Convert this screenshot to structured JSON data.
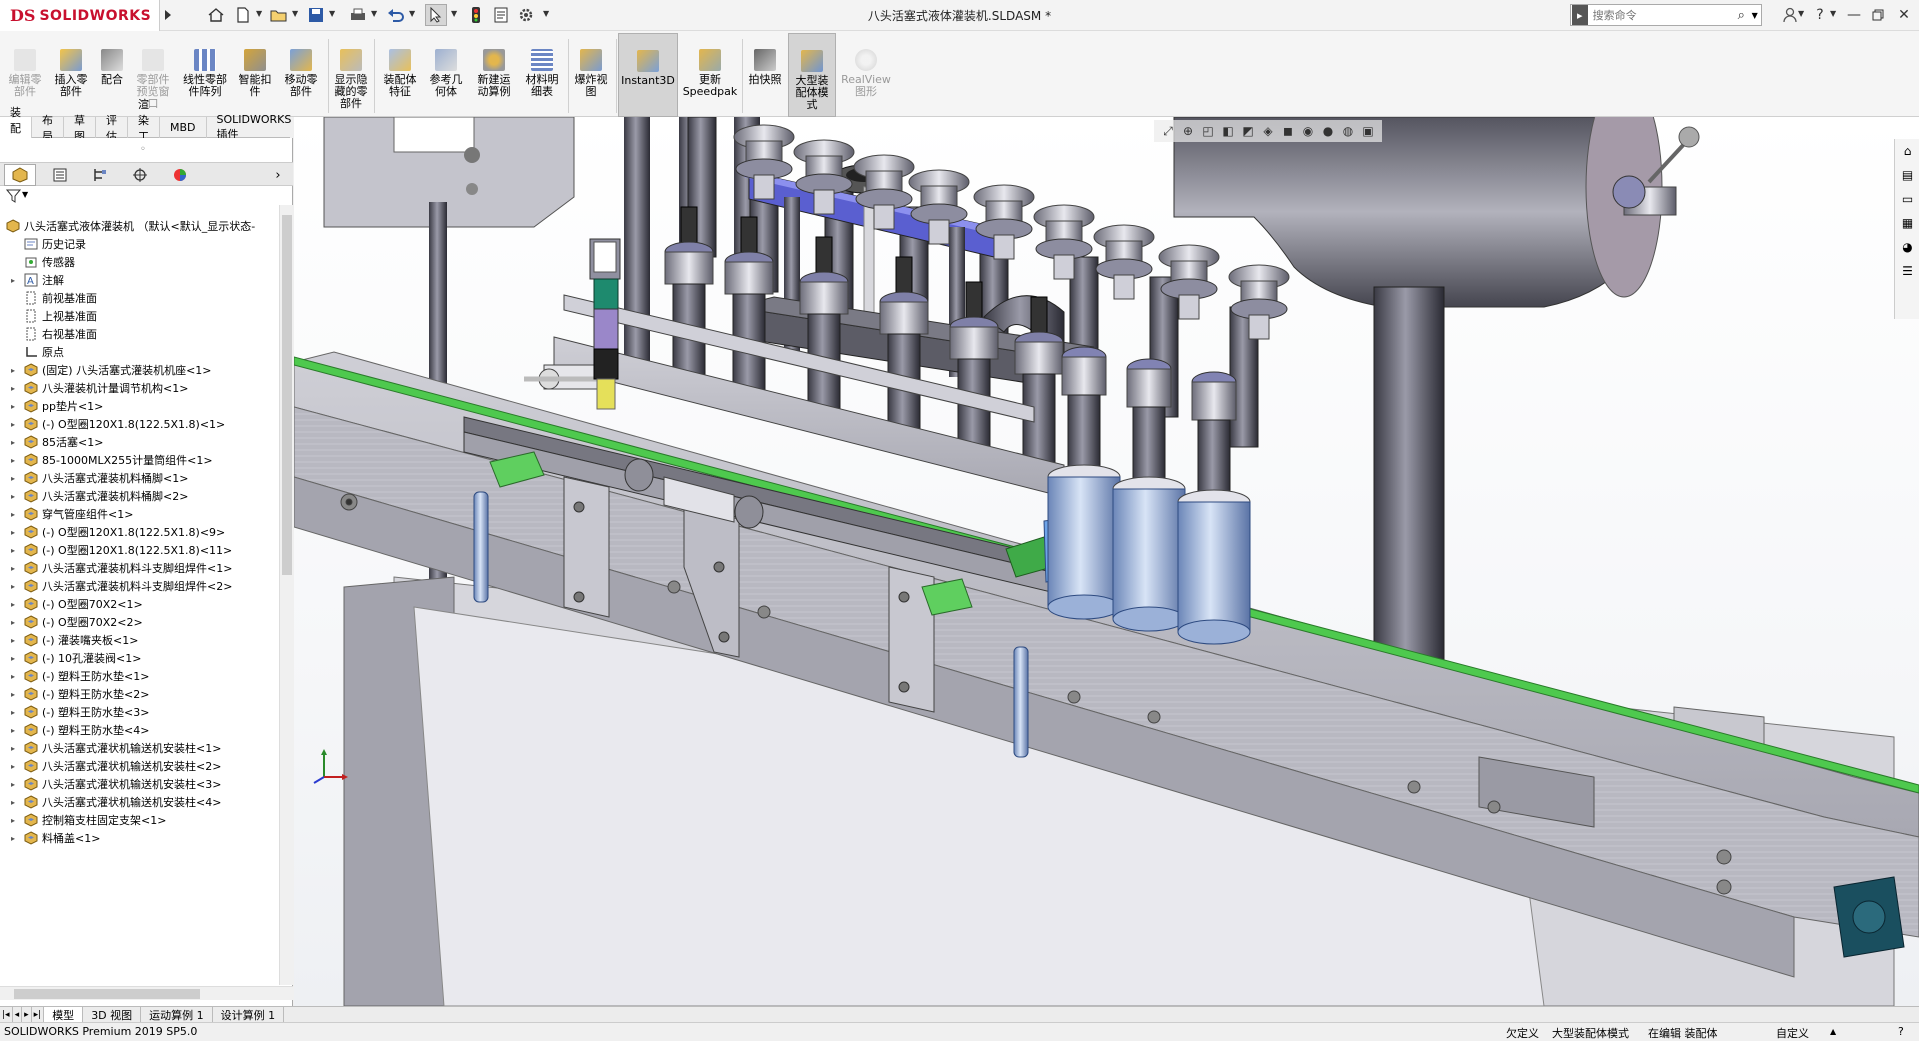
{
  "titlebar": {
    "brand": "SOLIDWORKS",
    "brand_mark": "DS",
    "document_title": "八头活塞式液体灌装机.SLDASM *",
    "search_placeholder": "搜索命令"
  },
  "ribbon": {
    "buttons": [
      {
        "label": "编辑零\n部件",
        "enabled": false
      },
      {
        "label": "插入零\n部件",
        "enabled": true
      },
      {
        "label": "配合",
        "enabled": true
      },
      {
        "label": "零部件\n预览窗\n口",
        "enabled": false
      },
      {
        "label": "线性零部\n件阵列",
        "enabled": true
      },
      {
        "label": "智能扣\n件",
        "enabled": true
      },
      {
        "label": "移动零\n部件",
        "enabled": true
      },
      {
        "label": "显示隐\n藏的零\n部件",
        "enabled": true
      },
      {
        "label": "装配体\n特征",
        "enabled": true
      },
      {
        "label": "参考几\n何体",
        "enabled": true
      },
      {
        "label": "新建运\n动算例",
        "enabled": true
      },
      {
        "label": "材料明\n细表",
        "enabled": true
      },
      {
        "label": "爆炸视\n图",
        "enabled": true
      },
      {
        "label": "Instant3D",
        "enabled": true,
        "active": true
      },
      {
        "label": "更新\nSpeedpak",
        "enabled": true
      },
      {
        "label": "拍快照",
        "enabled": true
      },
      {
        "label": "大型装\n配体模\n式",
        "enabled": true,
        "active": true
      },
      {
        "label": "RealView\n图形",
        "enabled": false
      }
    ]
  },
  "command_tabs": [
    "装配体",
    "布局",
    "草图",
    "评估",
    "渲染工具",
    "MBD",
    "SOLIDWORKS 插件"
  ],
  "feature_tree": {
    "root": "八头活塞式液体灌装机 （默认<默认_显示状态-",
    "items": [
      {
        "label": "历史记录",
        "expand": false,
        "icon": "history-icon"
      },
      {
        "label": "传感器",
        "expand": false,
        "icon": "sensor-icon"
      },
      {
        "label": "注解",
        "expand": true,
        "icon": "annotation-icon"
      },
      {
        "label": "前视基准面",
        "expand": false,
        "icon": "plane-icon"
      },
      {
        "label": "上视基准面",
        "expand": false,
        "icon": "plane-icon"
      },
      {
        "label": "右视基准面",
        "expand": false,
        "icon": "plane-icon"
      },
      {
        "label": "原点",
        "expand": false,
        "icon": "origin-icon"
      },
      {
        "label": "(固定) 八头活塞式灌装机机座<1>",
        "expand": true,
        "icon": "assembly-icon"
      },
      {
        "label": "八头灌装机计量调节机构<1>",
        "expand": true,
        "icon": "assembly-icon"
      },
      {
        "label": "pp垫片<1>",
        "expand": true,
        "icon": "assembly-icon"
      },
      {
        "label": "(-) O型圈120X1.8(122.5X1.8)<1>",
        "expand": true,
        "icon": "assembly-icon"
      },
      {
        "label": "85活塞<1>",
        "expand": true,
        "icon": "assembly-icon"
      },
      {
        "label": "85-1000MLX255计量筒组件<1>",
        "expand": true,
        "icon": "assembly-icon"
      },
      {
        "label": "八头活塞式灌装机料桶脚<1>",
        "expand": true,
        "icon": "assembly-icon"
      },
      {
        "label": "八头活塞式灌装机料桶脚<2>",
        "expand": true,
        "icon": "assembly-icon"
      },
      {
        "label": "穿气管座组件<1>",
        "expand": true,
        "icon": "assembly-icon"
      },
      {
        "label": "(-) O型圈120X1.8(122.5X1.8)<9>",
        "expand": true,
        "icon": "assembly-icon"
      },
      {
        "label": "(-) O型圈120X1.8(122.5X1.8)<11>",
        "expand": true,
        "icon": "assembly-icon"
      },
      {
        "label": "八头活塞式灌装机料斗支脚组焊件<1>",
        "expand": true,
        "icon": "assembly-icon"
      },
      {
        "label": "八头活塞式灌装机料斗支脚组焊件<2>",
        "expand": true,
        "icon": "assembly-icon"
      },
      {
        "label": "(-) O型圈70X2<1>",
        "expand": true,
        "icon": "assembly-icon"
      },
      {
        "label": "(-) O型圈70X2<2>",
        "expand": true,
        "icon": "assembly-icon"
      },
      {
        "label": "(-) 灌装嘴夹板<1>",
        "expand": true,
        "icon": "assembly-icon"
      },
      {
        "label": "(-) 10孔灌装阀<1>",
        "expand": true,
        "icon": "assembly-icon"
      },
      {
        "label": "(-) 塑料王防水垫<1>",
        "expand": true,
        "icon": "assembly-icon"
      },
      {
        "label": "(-) 塑料王防水垫<2>",
        "expand": true,
        "icon": "assembly-icon"
      },
      {
        "label": "(-) 塑料王防水垫<3>",
        "expand": true,
        "icon": "assembly-icon"
      },
      {
        "label": "(-) 塑料王防水垫<4>",
        "expand": true,
        "icon": "assembly-icon"
      },
      {
        "label": "八头活塞式灌状机输送机安装柱<1>",
        "expand": true,
        "icon": "assembly-icon"
      },
      {
        "label": "八头活塞式灌状机输送机安装柱<2>",
        "expand": true,
        "icon": "assembly-icon"
      },
      {
        "label": "八头活塞式灌状机输送机安装柱<3>",
        "expand": true,
        "icon": "assembly-icon"
      },
      {
        "label": "八头活塞式灌状机输送机安装柱<4>",
        "expand": true,
        "icon": "assembly-icon"
      },
      {
        "label": "控制箱支柱固定支架<1>",
        "expand": true,
        "icon": "assembly-icon"
      },
      {
        "label": "料桶盖<1>",
        "expand": true,
        "icon": "assembly-icon"
      }
    ]
  },
  "bottom_tabs": [
    "模型",
    "3D 视图",
    "运动算例 1",
    "设计算例 1"
  ],
  "status": {
    "product": "SOLIDWORKS Premium 2019 SP5.0",
    "underdefined": "欠定义",
    "mode": "大型装配体模式",
    "editing": "在编辑 装配体",
    "custom": "自定义"
  },
  "colors": {
    "accent_green": "#4ec94e",
    "brand_red": "#c8102e",
    "machine_gray": "#b9b9c3",
    "piston_blue": "#8aa9d6",
    "plate_blue": "#5a5fd0"
  }
}
